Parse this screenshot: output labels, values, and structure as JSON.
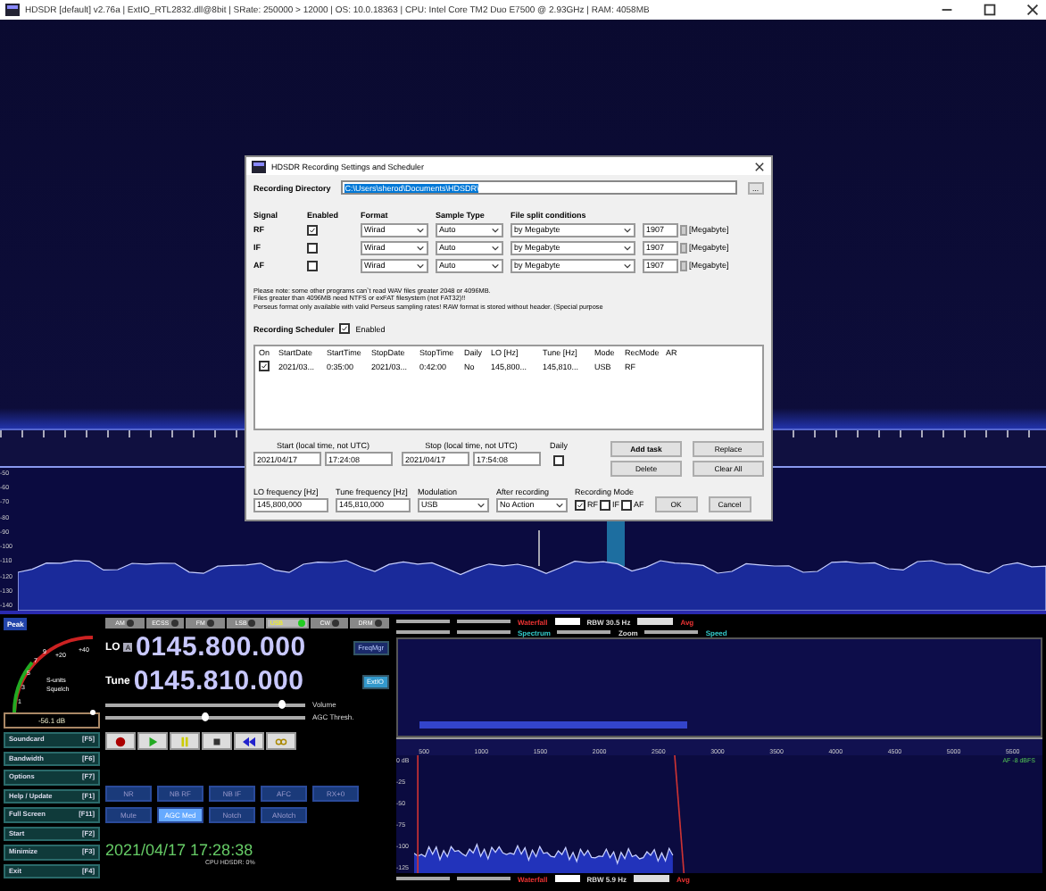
{
  "window": {
    "title": "HDSDR  [default]  v2.76a  |  ExtIO_RTL2832.dll@8bit  |  SRate: 250000 > 12000  |  OS: 10.0.18363  |  CPU: Intel Core TM2 Duo   E7500  @ 2.93GHz | RAM: 4058MB"
  },
  "rf_spectrum": {
    "db_labels": [
      "-50",
      "-60",
      "-70",
      "-80",
      "-90",
      "-100",
      "-110",
      "-120",
      "-130",
      "-140"
    ]
  },
  "dialog": {
    "title": "HDSDR Recording Settings and Scheduler",
    "directory_label": "Recording Directory",
    "directory": "C:\\Users\\sherod\\Documents\\HDSDR\\",
    "browse": "...",
    "signal_headers": [
      "Signal",
      "Enabled",
      "Format",
      "Sample Type",
      "File split conditions"
    ],
    "signals": [
      {
        "name": "RF",
        "enabled": true,
        "format": "Wirad",
        "sample_type": "Auto",
        "split": "by Megabyte",
        "size": "1907",
        "unit": "[Megabyte]"
      },
      {
        "name": "IF",
        "enabled": false,
        "format": "Wirad",
        "sample_type": "Auto",
        "split": "by Megabyte",
        "size": "1907",
        "unit": "[Megabyte]"
      },
      {
        "name": "AF",
        "enabled": false,
        "format": "Wirad",
        "sample_type": "Auto",
        "split": "by Megabyte",
        "size": "1907",
        "unit": "[Megabyte]"
      }
    ],
    "note": [
      "Please note: some other programs can`t read WAV files greater 2048 or 4096MB.",
      "Files greater than 4096MB need NTFS or exFAT filesystem (not FAT32)!!",
      "Perseus format only available with valid Perseus sampling rates! RAW format is stored without header. (Special purpose"
    ],
    "scheduler_label": "Recording Scheduler",
    "scheduler_enabled": {
      "label": "Enabled",
      "checked": true
    },
    "columns": [
      "On",
      "StartDate",
      "StartTime",
      "StopDate",
      "StopTime",
      "Daily",
      "LO [Hz]",
      "Tune [Hz]",
      "Mode",
      "RecMode",
      "AR"
    ],
    "tasks": [
      {
        "on": true,
        "cells": [
          "2021/03...",
          "0:35:00",
          "2021/03...",
          "0:42:00",
          "No",
          "145,800...",
          "145,810...",
          "USB",
          "RF"
        ]
      }
    ],
    "start_label": "Start (local time, not UTC)",
    "start_date": "2021/04/17",
    "start_time": "17:24:08",
    "stop_label": "Stop (local time, not UTC)",
    "stop_date": "2021/04/17",
    "stop_time": "17:54:08",
    "daily": {
      "label": "Daily",
      "checked": false
    },
    "buttons": [
      "Add task",
      "Replace",
      "Delete",
      "Clear All"
    ],
    "lo_label": "LO frequency [Hz]",
    "lo": "145,800,000",
    "tune_label": "Tune frequency [Hz]",
    "tune": "145,810,000",
    "mod_label": "Modulation",
    "mod": "USB",
    "after_label": "After recording",
    "after": "No Action",
    "rec_mode_label": "Recording Mode",
    "rec_modes": [
      {
        "label": "RF",
        "checked": true
      },
      {
        "label": "IF",
        "checked": false
      },
      {
        "label": "AF",
        "checked": false
      }
    ],
    "ok": "OK",
    "cancel": "Cancel"
  },
  "control": {
    "peak": "Peak",
    "meter_scale": [
      "1",
      "3",
      "5",
      "7",
      "9",
      "+20",
      "+40"
    ],
    "meter_label": "S-units",
    "squelch_label": "Squelch",
    "reading": "-56.1 dB",
    "left_buttons": [
      {
        "label": "Soundcard",
        "key": "[F5]"
      },
      {
        "label": "Bandwidth",
        "key": "[F6]"
      },
      {
        "label": "Options",
        "key": "[F7]"
      },
      {
        "label": "Help / Update",
        "key": "[F1]"
      },
      {
        "label": "Full Screen",
        "key": "[F11]"
      },
      {
        "label": "Start",
        "key": "[F2]"
      },
      {
        "label": "Minimize",
        "key": "[F3]"
      },
      {
        "label": "Exit",
        "key": "[F4]"
      }
    ],
    "modes": [
      {
        "label": "AM",
        "selected": false
      },
      {
        "label": "ECSS",
        "selected": false
      },
      {
        "label": "FM",
        "selected": false
      },
      {
        "label": "LSB",
        "selected": false
      },
      {
        "label": "USB",
        "selected": true
      },
      {
        "label": "CW",
        "selected": false
      },
      {
        "label": "DRM",
        "selected": false
      }
    ],
    "lo_label": "LO",
    "lo_badge": "A",
    "lo": "0145.800.000",
    "tune_label": "Tune",
    "tune": "0145.810.000",
    "freqmgr": "FreqMgr",
    "extio": "ExtIO",
    "volume": {
      "label": "Volume",
      "level": 0.88
    },
    "agc": {
      "label": "AGC Thresh.",
      "level": 0.5
    },
    "dsp": [
      {
        "label": "NR",
        "on": false
      },
      {
        "label": "NB RF",
        "on": false
      },
      {
        "label": "NB IF",
        "on": false
      },
      {
        "label": "AFC",
        "on": false
      },
      {
        "label": "RX+0",
        "on": false
      },
      {
        "label": "Mute",
        "on": false
      },
      {
        "label": "AGC Med",
        "on": true
      },
      {
        "label": "Notch",
        "on": false
      },
      {
        "label": "ANotch",
        "on": false
      }
    ],
    "clock": "2021/04/17 17:28:38",
    "cpu": "CPU HDSDR:  0%"
  },
  "audio": {
    "waterfall": "Waterfall",
    "rbw": "RBW 30.5 Hz",
    "avg": "Avg",
    "spectrum": "Spectrum",
    "zoom": "Zoom",
    "speed": "Speed",
    "freq_labels": [
      "500",
      "1000",
      "1500",
      "2000",
      "2500",
      "3000",
      "3500",
      "4000",
      "4500",
      "5000",
      "5500"
    ],
    "db_labels": [
      "0 dB",
      "-25",
      "-50",
      "-75",
      "-100",
      "-125"
    ],
    "af_level": "AF -8 dBFS",
    "waterfall_2": "Waterfall",
    "rbw_2": "RBW 5.9 Hz",
    "avg_2": "Avg"
  }
}
